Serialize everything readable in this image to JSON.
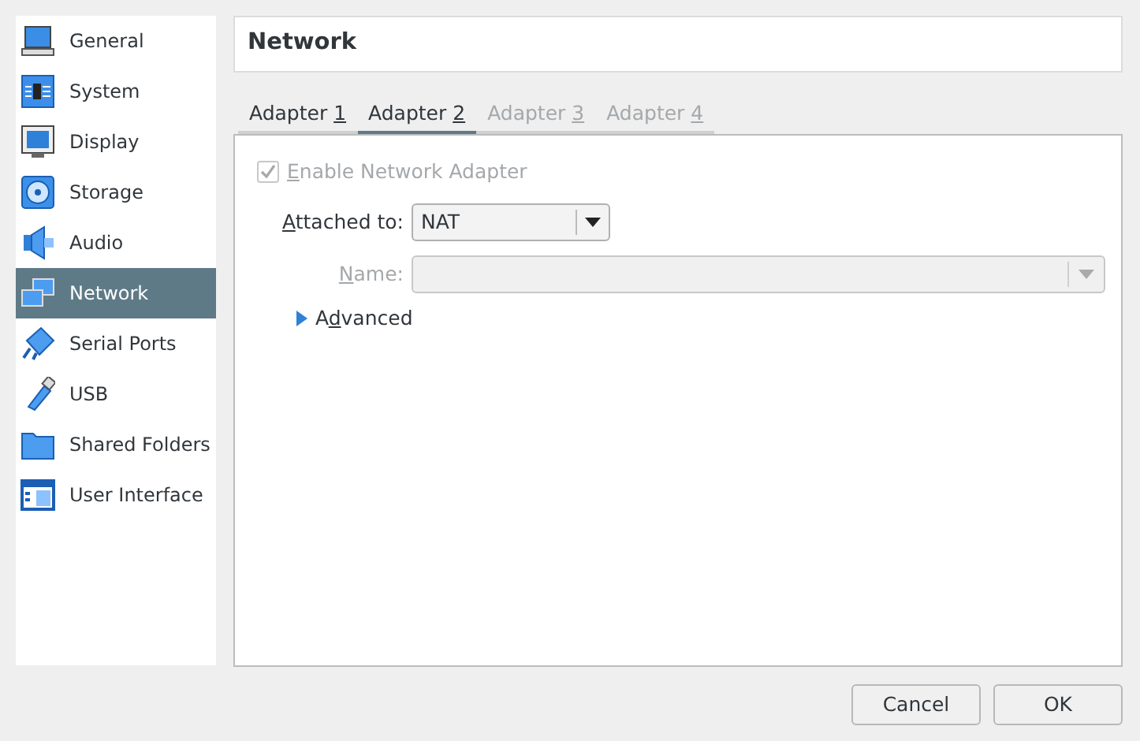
{
  "sidebar": {
    "items": [
      {
        "label": "General",
        "kind": "general",
        "selected": false
      },
      {
        "label": "System",
        "kind": "system",
        "selected": false
      },
      {
        "label": "Display",
        "kind": "display",
        "selected": false
      },
      {
        "label": "Storage",
        "kind": "storage",
        "selected": false
      },
      {
        "label": "Audio",
        "kind": "audio",
        "selected": false
      },
      {
        "label": "Network",
        "kind": "network",
        "selected": true
      },
      {
        "label": "Serial Ports",
        "kind": "serial",
        "selected": false
      },
      {
        "label": "USB",
        "kind": "usb",
        "selected": false
      },
      {
        "label": "Shared Folders",
        "kind": "folder",
        "selected": false
      },
      {
        "label": "User Interface",
        "kind": "ui",
        "selected": false
      }
    ]
  },
  "header": {
    "title": "Network"
  },
  "tabs": [
    {
      "label": {
        "before": "Adapter ",
        "key": "1"
      },
      "selected": false,
      "disabled": false
    },
    {
      "label": {
        "before": "Adapter ",
        "key": "2"
      },
      "selected": true,
      "disabled": false
    },
    {
      "label": {
        "before": "Adapter ",
        "key": "3"
      },
      "selected": false,
      "disabled": true
    },
    {
      "label": {
        "before": "Adapter ",
        "key": "4"
      },
      "selected": false,
      "disabled": true
    }
  ],
  "adapter": {
    "enable": {
      "label": {
        "key": "E",
        "after": "nable Network Adapter"
      },
      "checked": true,
      "disabled": true
    },
    "attached_to": {
      "label": {
        "key": "A",
        "after": "ttached to:"
      },
      "value": "NAT"
    },
    "name": {
      "label": {
        "key": "N",
        "after": "ame:"
      },
      "disabled": true
    },
    "advanced": {
      "label": {
        "before": "A",
        "key": "d",
        "after": "vanced"
      },
      "expanded": false
    }
  },
  "buttons": [
    {
      "label": "Cancel"
    },
    {
      "label": "OK"
    }
  ]
}
